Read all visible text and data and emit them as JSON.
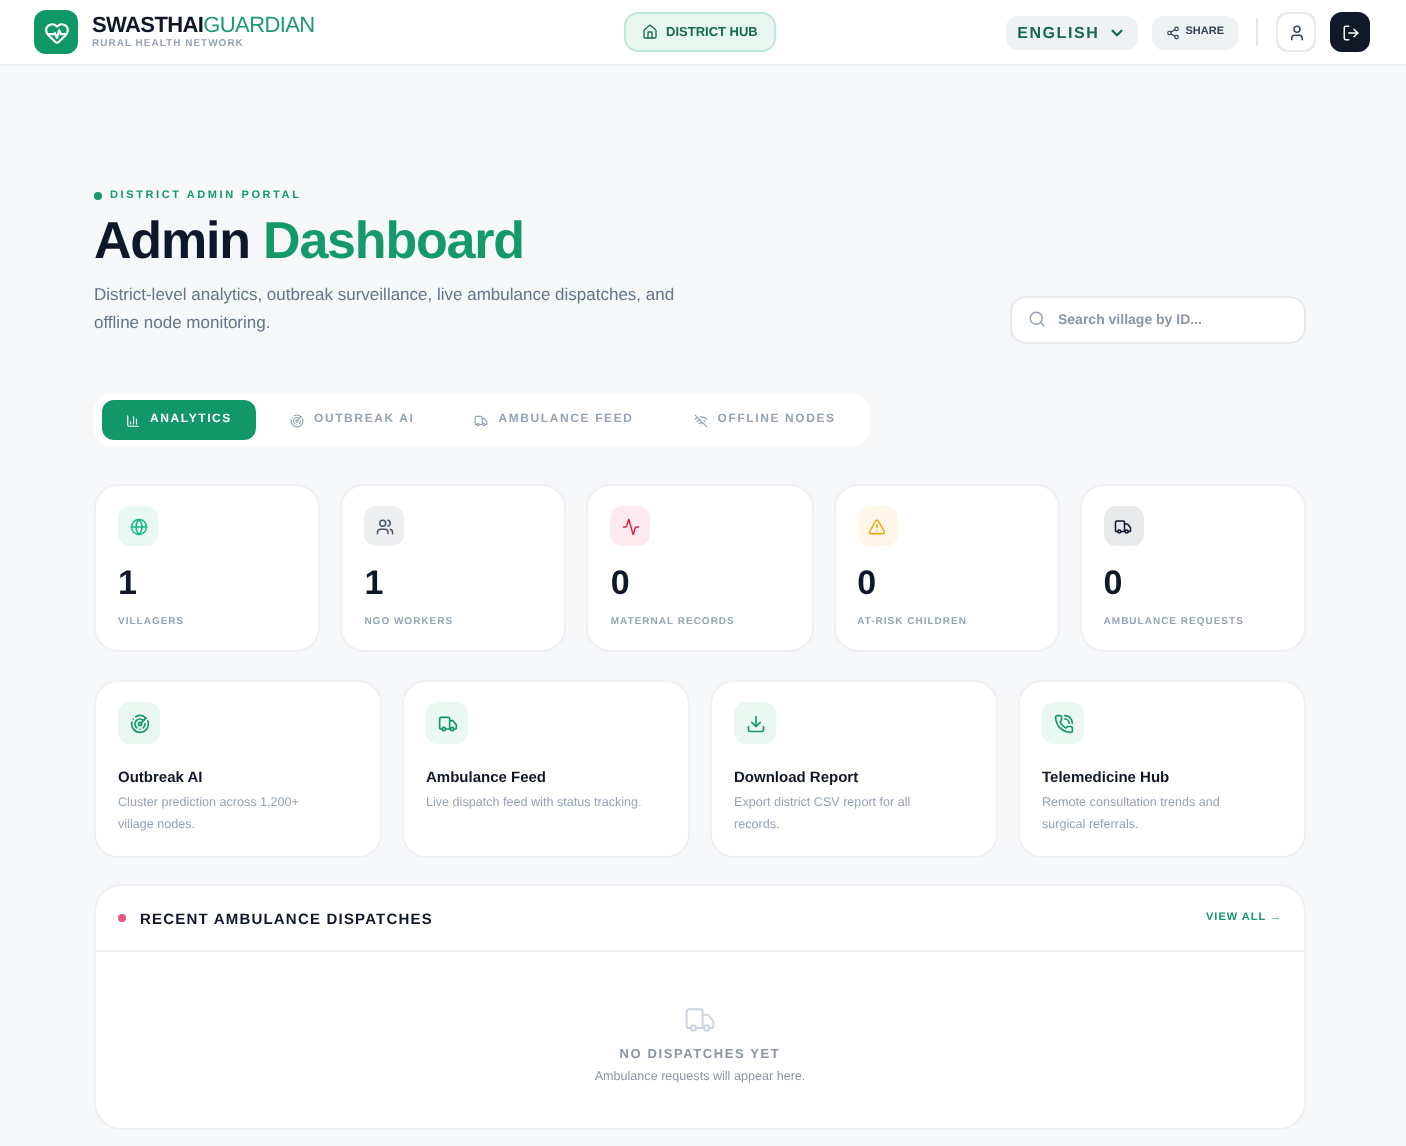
{
  "header": {
    "brand_primary": "SWASTHAI",
    "brand_secondary": "GUARDIAN",
    "tagline": "RURAL HEALTH NETWORK",
    "hub_button": "DISTRICT HUB",
    "language": "ENGLISH",
    "share": "SHARE"
  },
  "hero": {
    "eyebrow": "DISTRICT ADMIN PORTAL",
    "title_primary": "Admin",
    "title_secondary": "Dashboard",
    "subtitle": "District-level analytics, outbreak surveillance, live ambulance dispatches, and offline node monitoring.",
    "search": {
      "placeholder": "Search village by ID..."
    }
  },
  "tabs": [
    {
      "label": "ANALYTICS",
      "selected": true
    },
    {
      "label": "OUTBREAK AI",
      "selected": false
    },
    {
      "label": "AMBULANCE FEED",
      "selected": false
    },
    {
      "label": "OFFLINE NODES",
      "selected": false
    }
  ],
  "stats": [
    {
      "value": "1",
      "label": "VILLAGERS",
      "color": "#10b981"
    },
    {
      "value": "1",
      "label": "NGO WORKERS",
      "color": "#475569"
    },
    {
      "value": "0",
      "label": "MATERNAL RECORDS",
      "color": "#e11d48"
    },
    {
      "value": "0",
      "label": "AT-RISK CHILDREN",
      "color": "#f59e0b"
    },
    {
      "value": "0",
      "label": "AMBULANCE REQUESTS",
      "color": "#0f172a"
    }
  ],
  "features": [
    {
      "title": "Outbreak AI",
      "description": "Cluster prediction across 1,200+ village nodes."
    },
    {
      "title": "Ambulance Feed",
      "description": "Live dispatch feed with status tracking."
    },
    {
      "title": "Download Report",
      "description": "Export district CSV report for all records."
    },
    {
      "title": "Telemedicine Hub",
      "description": "Remote consultation trends and surgical referrals."
    }
  ],
  "dispatches": {
    "title": "RECENT AMBULANCE DISPATCHES",
    "view_all": "VIEW ALL →",
    "empty_title": "NO DISPATCHES YET",
    "empty_text": "Ambulance requests will appear here."
  }
}
